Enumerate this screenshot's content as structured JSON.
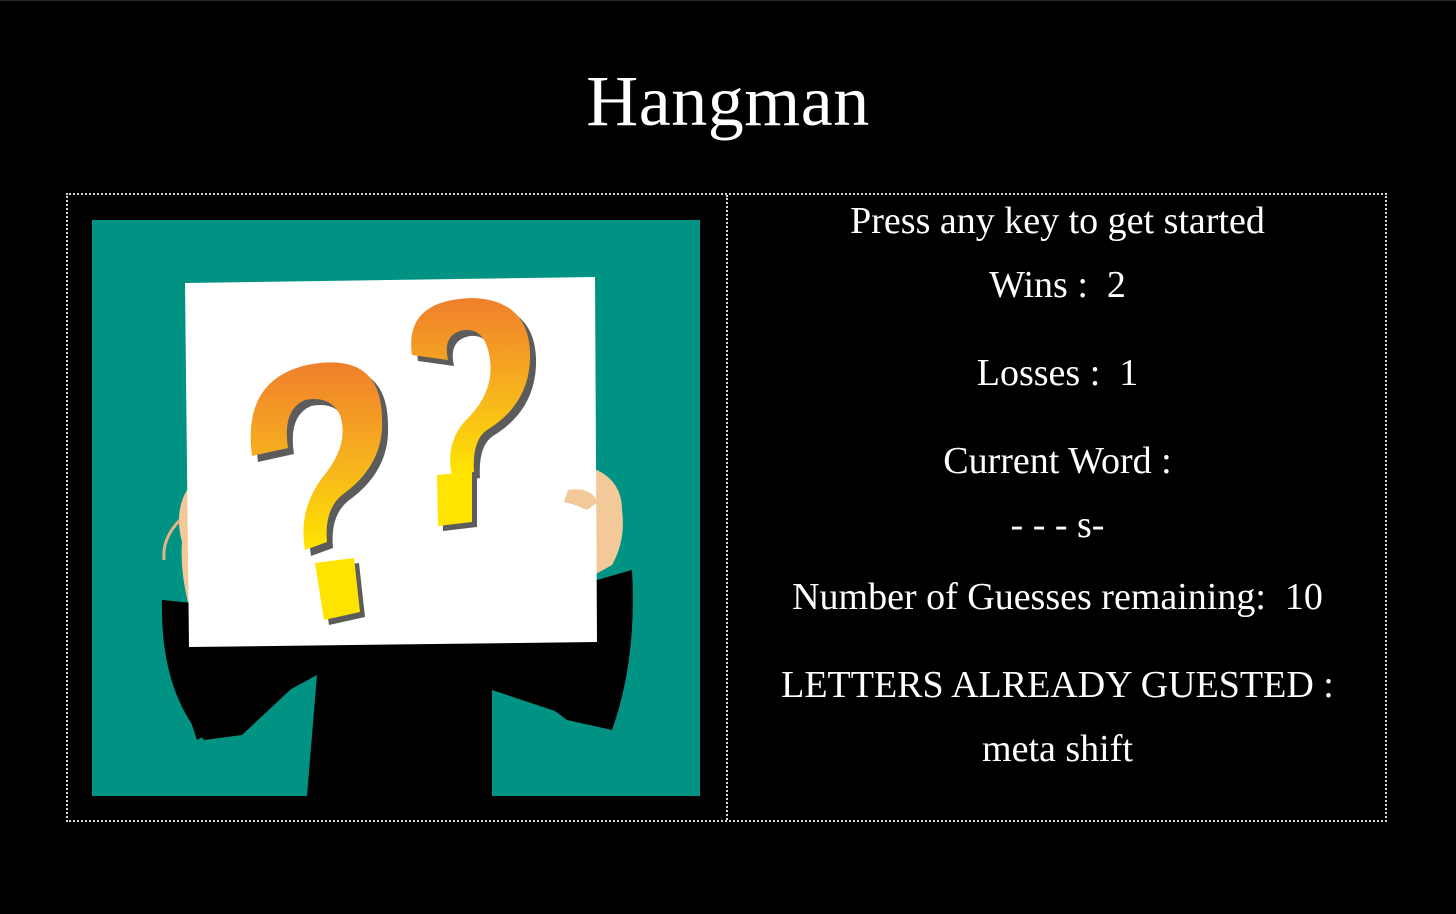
{
  "title": "Hangman",
  "prompt": "Press any key to get started",
  "stats": {
    "wins_label": "Wins :",
    "wins_value": "2",
    "losses_label": "Losses :",
    "losses_value": "1"
  },
  "word": {
    "label": "Current Word :",
    "display": "- - - s-"
  },
  "guesses": {
    "label": "Number of Guesses remaining:",
    "value": "10"
  },
  "letters": {
    "label": "LETTERS ALREADY GUESTED :",
    "value": "meta shift"
  },
  "colors": {
    "background": "#000000",
    "panel_teal": "#009384",
    "text": "#ffffff",
    "question_orange": "#f08a2c",
    "question_yellow": "#ffe400"
  },
  "icons": {
    "hero_image": "person-holding-question-marks-sign"
  }
}
